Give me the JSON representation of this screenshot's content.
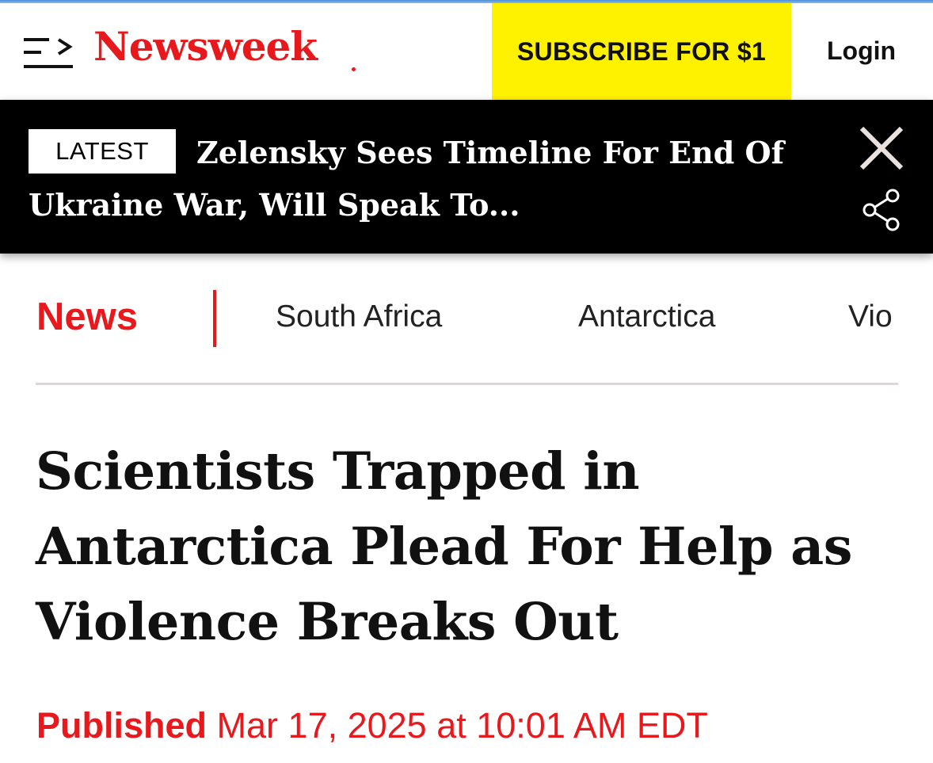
{
  "header": {
    "logo": "Newsweek",
    "subscribe_label": "SUBSCRIBE FOR $1",
    "login_label": "Login"
  },
  "latest": {
    "badge": "LATEST",
    "headline": "Zelensky Sees Timeline For End Of Ukraine War, Will Speak To..."
  },
  "nav": {
    "section": "News",
    "items": [
      "South Africa",
      "Antarctica",
      "Vio"
    ]
  },
  "article": {
    "headline": "Scientists Trapped in Antarctica Plead For Help as Violence Breaks Out",
    "published_label": "Published",
    "published_date": "Mar 17, 2025 at 10:01 AM EDT"
  },
  "colors": {
    "brand_red": "#e8191d",
    "subscribe_yellow": "#fff200",
    "latest_bg": "#000000"
  },
  "icons": [
    "menu-icon",
    "close-icon",
    "share-icon"
  ]
}
